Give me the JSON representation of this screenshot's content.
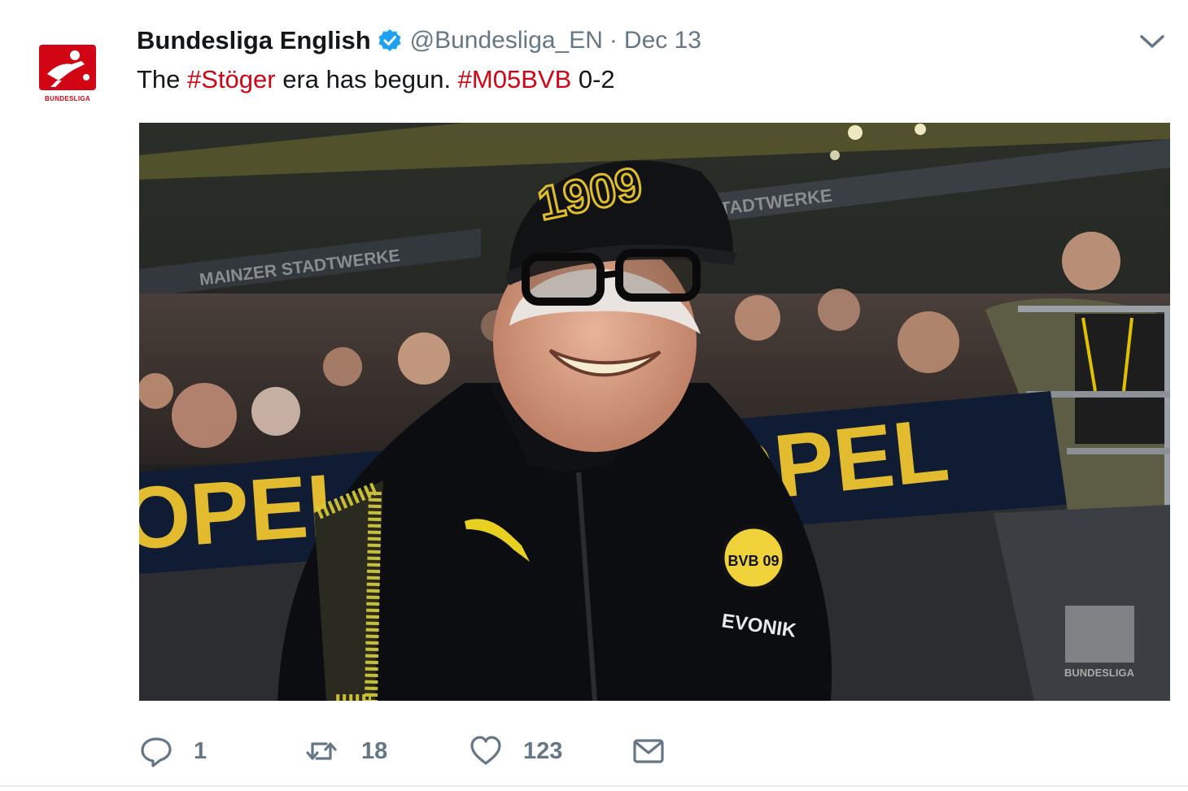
{
  "tweet": {
    "account_name": "Bundesliga English",
    "handle": "@Bundesliga_EN",
    "separator": "·",
    "date": "Dec 13",
    "avatar_label": "BUNDESLIGA",
    "text_prefix": "The ",
    "hashtag_1": "#Stöger",
    "text_middle": " era has begun. ",
    "hashtag_2": "#M05BVB",
    "text_suffix": " 0-2",
    "brand_color": "#d20515",
    "verified_color": "#1da1f2"
  },
  "photo": {
    "board_text": "OPEL",
    "board_text_left": "OPEL",
    "banner_left": "MAINZER STADTWERKE",
    "banner_right": "STADTWERKE",
    "cap_text": "1909",
    "sponsor": "EVONIK",
    "crest": "BVB 09",
    "watermark": "BUNDESLIGA"
  },
  "actions": {
    "reply_count": "1",
    "retweet_count": "18",
    "like_count": "123",
    "icons": [
      "reply-icon",
      "retweet-icon",
      "like-icon",
      "message-icon"
    ]
  }
}
